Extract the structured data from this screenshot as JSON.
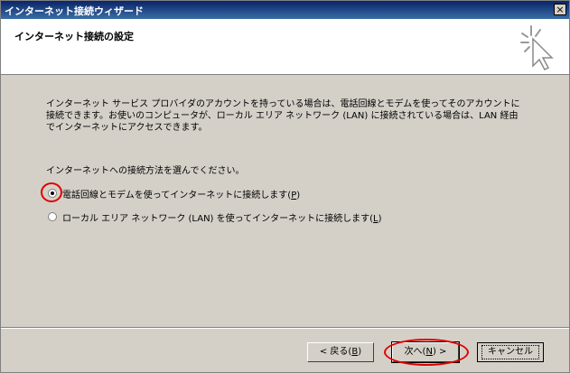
{
  "window": {
    "title": "インターネット接続ウィザード",
    "close_label": "×"
  },
  "header": {
    "title": "インターネット接続の設定",
    "icon": "sparkle-cursor-icon"
  },
  "main": {
    "intro": "インターネット サービス プロバイダのアカウントを持っている場合は、電話回線とモデムを使ってそのアカウントに接続できます。お使いのコンピュータが、ローカル エリア ネットワーク (LAN) に接続されている場合は、LAN 経由でインターネットにアクセスできます。",
    "prompt": "インターネットへの接続方法を選んでください。",
    "options": [
      {
        "label": "電話回線とモデムを使ってインターネットに接続します(",
        "key": "P",
        "suffix": ")",
        "checked": true
      },
      {
        "label": "ローカル エリア ネットワーク (LAN) を使ってインターネットに接続します(",
        "key": "L",
        "suffix": ")",
        "checked": false
      }
    ]
  },
  "footer": {
    "back": {
      "label": "< 戻る(",
      "key": "B",
      "suffix": ")"
    },
    "next": {
      "label": "次へ(",
      "key": "N",
      "suffix": ") >"
    },
    "cancel": {
      "label": "キャンセル"
    }
  },
  "annotation_color": "#e00000"
}
